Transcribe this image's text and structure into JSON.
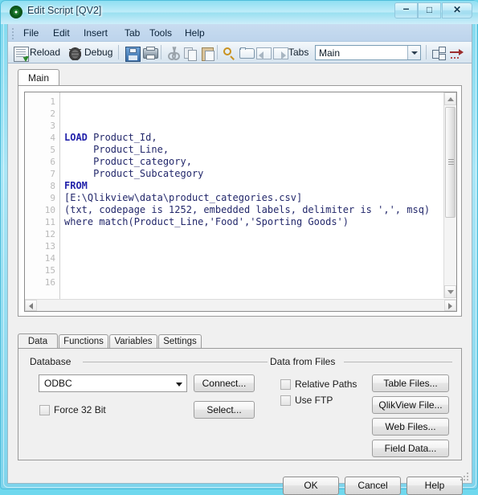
{
  "window": {
    "title": "Edit Script [QV2]",
    "icon": "qlikview-logo-icon",
    "minimize_label": "–",
    "maximize_label": "□",
    "close_label": "✕"
  },
  "menubar": {
    "items": [
      "File",
      "Edit",
      "Insert",
      "Tab",
      "Tools",
      "Help"
    ]
  },
  "toolbar": {
    "reload_label": "Reload",
    "debug_label": "Debug",
    "tabs_label": "Tabs",
    "tabs_combo_value": "Main",
    "icons": [
      "reload-icon",
      "debug-icon",
      "save-icon",
      "print-icon",
      "cut-icon",
      "copy-icon",
      "paste-icon",
      "search-icon",
      "open-folder-icon",
      "previous-tab-icon",
      "next-tab-icon",
      "organize-tabs-icon",
      "goto-icon"
    ]
  },
  "script_tabs": {
    "active": "Main",
    "items": [
      "Main"
    ]
  },
  "editor": {
    "line_numbers": [
      1,
      2,
      3,
      4,
      5,
      6,
      7,
      8,
      9,
      10,
      11,
      12,
      13,
      14,
      15,
      16
    ],
    "lines": [
      {
        "num": 1,
        "segments": []
      },
      {
        "num": 2,
        "segments": []
      },
      {
        "num": 3,
        "segments": []
      },
      {
        "num": 4,
        "segments": [
          {
            "t": "LOAD",
            "c": "kw"
          },
          {
            "t": " Product_Id,",
            "c": "nm"
          }
        ]
      },
      {
        "num": 5,
        "segments": [
          {
            "t": "     Product_Line,",
            "c": "nm"
          }
        ]
      },
      {
        "num": 6,
        "segments": [
          {
            "t": "     Product_category,",
            "c": "nm"
          }
        ]
      },
      {
        "num": 7,
        "segments": [
          {
            "t": "     Product_Subcategory",
            "c": "nm"
          }
        ]
      },
      {
        "num": 8,
        "segments": [
          {
            "t": "FROM",
            "c": "kw"
          }
        ]
      },
      {
        "num": 9,
        "segments": [
          {
            "t": "[E:\\Qlikview\\data\\product_categories.csv]",
            "c": "nm"
          }
        ]
      },
      {
        "num": 10,
        "segments": [
          {
            "t": "(txt, codepage is 1252, embedded labels, delimiter is ',', msq)",
            "c": "nm"
          }
        ]
      },
      {
        "num": 11,
        "segments": [
          {
            "t": "where match(Product_Line,'Food','Sporting Goods')",
            "c": "nm"
          }
        ]
      },
      {
        "num": 12,
        "segments": []
      },
      {
        "num": 13,
        "segments": []
      },
      {
        "num": 14,
        "segments": []
      },
      {
        "num": 15,
        "segments": []
      },
      {
        "num": 16,
        "segments": []
      }
    ],
    "scroll": {
      "vertical_up_icon": "scroll-up-icon",
      "vertical_down_icon": "scroll-down-icon",
      "horizontal_left_icon": "scroll-left-icon",
      "horizontal_right_icon": "scroll-right-icon"
    }
  },
  "lower_tabs": {
    "active": "Data",
    "items": [
      "Data",
      "Functions",
      "Variables",
      "Settings"
    ]
  },
  "data_panel": {
    "database": {
      "group_label": "Database",
      "combo_value": "ODBC",
      "connect_label": "Connect...",
      "select_label": "Select...",
      "force32_label": "Force 32 Bit",
      "force32_checked": false
    },
    "data_from_files": {
      "group_label": "Data from Files",
      "relative_paths_label": "Relative Paths",
      "relative_paths_checked": false,
      "use_ftp_label": "Use FTP",
      "use_ftp_checked": false,
      "buttons": [
        "Table Files...",
        "QlikView File...",
        "Web Files...",
        "Field Data..."
      ]
    }
  },
  "footer": {
    "ok_label": "OK",
    "cancel_label": "Cancel",
    "help_label": "Help"
  }
}
